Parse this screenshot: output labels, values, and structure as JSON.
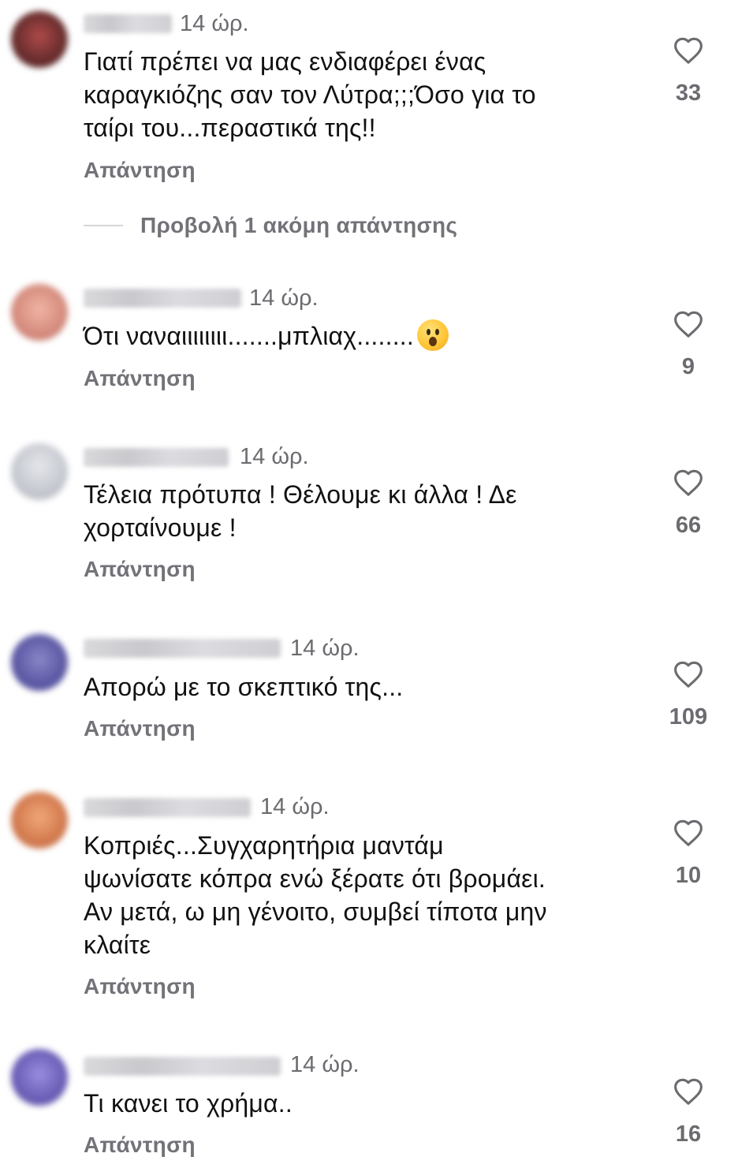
{
  "comments": [
    {
      "time": "14 ώρ.",
      "text": "Γιατί πρέπει να μας ενδιαφέρει ένας\nκαραγκιόζης σαν τον Λύτρα;;;Όσο για το\nταίρι του...περαστικά της!!",
      "reply": "Απάντηση",
      "likes": "33",
      "avatar_color": "#7a3a3a"
    },
    {
      "time": "14 ώρ.",
      "text": "Ότι ναναιιιιιιιι.......μπλιαχ........",
      "reply": "Απάντηση",
      "likes": "9",
      "avatar_color": "#d89a8c",
      "emoji": "hushed-face-emoji"
    },
    {
      "time": "14 ώρ.",
      "text": "Τέλεια πρότυπα ! Θέλουμε κι άλλα ! Δε\nχορταίνουμε !",
      "reply": "Απάντηση",
      "likes": "66",
      "avatar_color": "#c2c5cc"
    },
    {
      "time": "14 ώρ.",
      "text": "Απορώ με το σκεπτικό της...",
      "reply": "Απάντηση",
      "likes": "109",
      "avatar_color": "#6c6aa8"
    },
    {
      "time": "14 ώρ.",
      "text": "Κοπριές...Συγχαρητήρια μαντάμ\nψωνίσατε κόπρα ενώ ξέρατε ότι βρομάει.\nΑν μετά, ω μη γένοιτο, συμβεί τίποτα μην\nκλαίτε",
      "reply": "Απάντηση",
      "likes": "10",
      "avatar_color": "#d98a60"
    },
    {
      "time": "14 ώρ.",
      "text": "Τι κανει το χρήμα..",
      "reply": "Απάντηση",
      "likes": "16",
      "avatar_color": "#7a6ec0"
    }
  ],
  "view_more_replies": "Προβολή 1 ακόμη απάντησης",
  "colors": {
    "text": "#111111",
    "secondary": "#6b6b70",
    "reply": "#727278"
  },
  "icons": {
    "like": "heart-outline-icon"
  }
}
